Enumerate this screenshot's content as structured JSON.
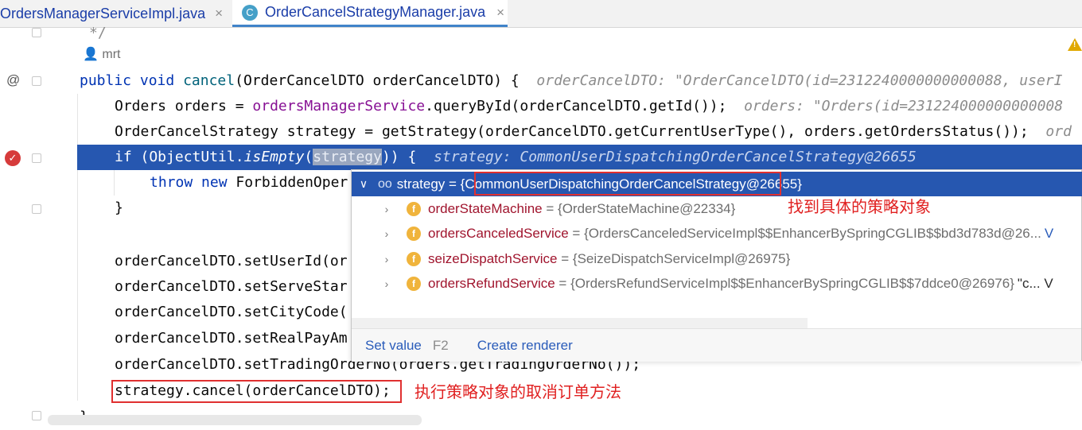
{
  "tabs": [
    {
      "label": "OrdersManagerServiceImpl.java",
      "close": "×"
    },
    {
      "label": "OrderCancelStrategyManager.java",
      "close": "×",
      "icon": "C"
    }
  ],
  "gutter": {
    "at_symbol": "@"
  },
  "code": {
    "comment_end": "*/",
    "author": "mrt",
    "l_public": "public",
    "l_void": "void",
    "l_cancel": "cancel",
    "l_sig": "(OrderCancelDTO orderCancelDTO) {",
    "l_sig_hint": "orderCancelDTO: \"OrderCancelDTO(id=2312240000000000088, userI",
    "l_orders_a": "Orders orders = ",
    "l_orders_field": "ordersManagerService",
    "l_orders_b": ".queryById(orderCancelDTO.getId());",
    "l_orders_hint": "orders: \"Orders(id=231224000000000008",
    "l_strategy": "OrderCancelStrategy strategy = getStrategy(orderCancelDTO.getCurrentUserType(), orders.getOrdersStatus());",
    "l_strategy_hint": "ord",
    "l_if_a": "if (ObjectUtil.",
    "l_if_m": "isEmpty",
    "l_if_b": "(",
    "l_if_word": "strategy",
    "l_if_c": ")) {",
    "l_if_hint": "strategy: CommonUserDispatchingOrderCancelStrategy@26655",
    "l_throw_kw": "throw",
    "l_new_kw": "new",
    "l_throw_rest": "ForbiddenOper",
    "l_close1": "}",
    "l_setuser": "orderCancelDTO.setUserId(or",
    "l_setserve": "orderCancelDTO.setServeStar",
    "l_setcity": "orderCancelDTO.setCityCode(",
    "l_setreal": "orderCancelDTO.setRealPayAm",
    "l_settrade": "orderCancelDTO.setTradingOrderNo(orders.getTradingOrderNo());",
    "l_call": "strategy.cancel(orderCancelDTO);",
    "l_close2": "}"
  },
  "annotations": {
    "find_object": "找到具体的策略对象",
    "execute": "执行策略对象的取消订单方法"
  },
  "popup": {
    "head": {
      "chevron": "∨",
      "icon": "oo",
      "name": "strategy",
      "eq": " = ",
      "value": "{CommonUserDispatchingOrderCancelStrategy",
      "suffix": "@26655}"
    },
    "rows": [
      {
        "chevron": "›",
        "icon": "f",
        "name": "orderStateMachine",
        "eq": " = ",
        "value": "{OrderStateMachine@22334}",
        "suffix": ""
      },
      {
        "chevron": "›",
        "icon": "f",
        "name": "ordersCanceledService",
        "eq": " = ",
        "value": "{OrdersCanceledServiceImpl$$EnhancerBySpringCGLIB$$bd3d783d@26...",
        "suffix": "V"
      },
      {
        "chevron": "›",
        "icon": "f",
        "name": "seizeDispatchService",
        "eq": " = ",
        "value": "{SeizeDispatchServiceImpl@26975}",
        "suffix": ""
      },
      {
        "chevron": "›",
        "icon": "f",
        "name": "ordersRefundService",
        "eq": " = ",
        "value": "{OrdersRefundServiceImpl$$EnhancerBySpringCGLIB$$7ddce0@26976}",
        "suffix": "\"c... V"
      }
    ],
    "footer": {
      "set_value": "Set value",
      "set_value_key": "F2",
      "create_renderer": "Create renderer"
    }
  },
  "colors": {
    "selection": "#2657b0",
    "annotation": "#e02020",
    "keyword": "#0033b3"
  }
}
